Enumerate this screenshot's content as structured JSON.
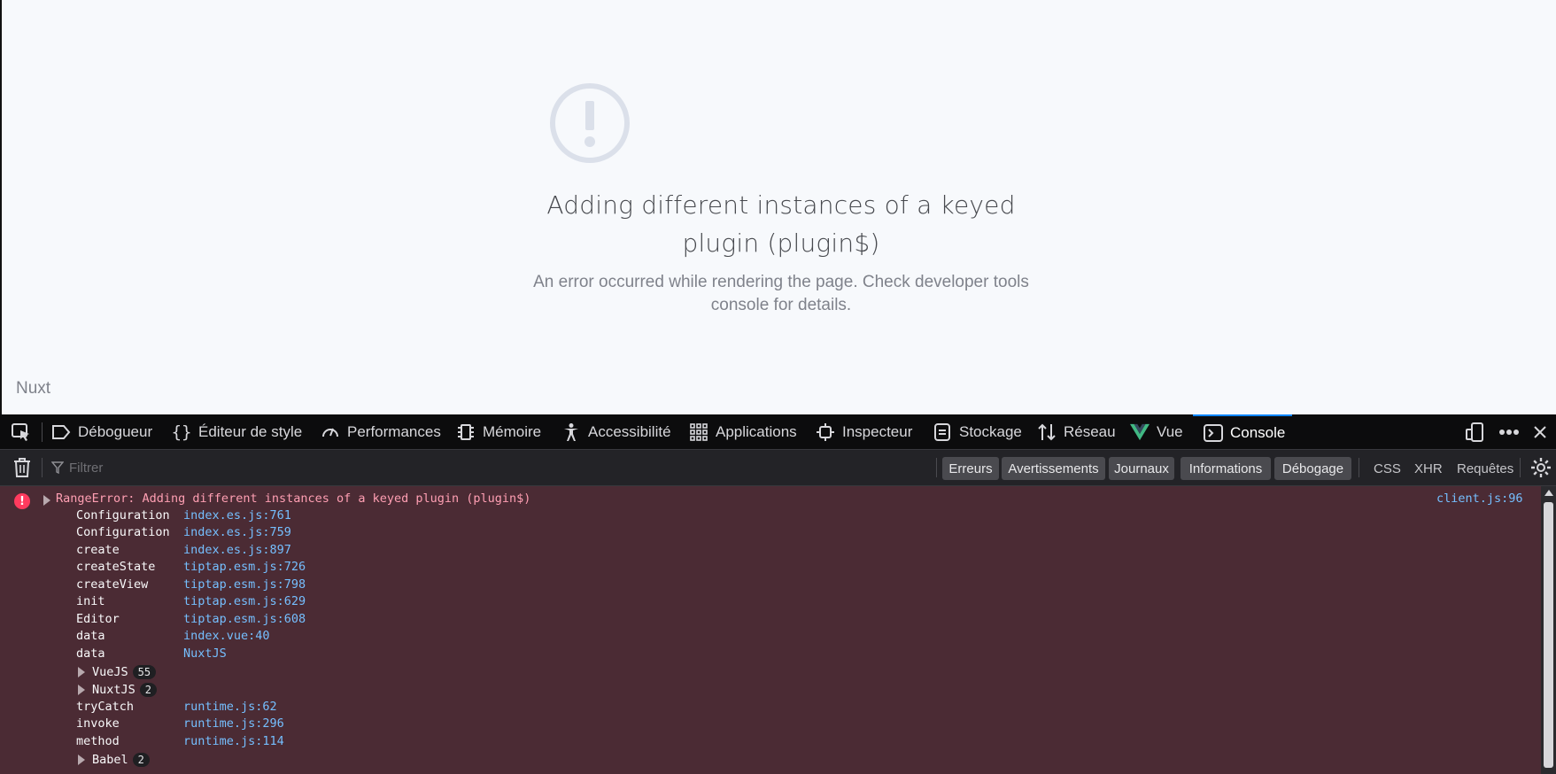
{
  "page": {
    "error_title": "Adding different instances of a keyed plugin (plugin$)",
    "error_description": "An error occurred while rendering the page. Check developer tools console for details.",
    "brand": "Nuxt"
  },
  "devtools": {
    "tabs": [
      {
        "label": "Débogueur",
        "icon": "debugger-icon"
      },
      {
        "label": "Éditeur de style",
        "icon": "braces-icon"
      },
      {
        "label": "Performances",
        "icon": "gauge-icon"
      },
      {
        "label": "Mémoire",
        "icon": "memory-chip-icon"
      },
      {
        "label": "Accessibilité",
        "icon": "accessibility-icon"
      },
      {
        "label": "Applications",
        "icon": "grid-icon"
      },
      {
        "label": "Inspecteur",
        "icon": "inspector-icon"
      },
      {
        "label": "Stockage",
        "icon": "storage-icon"
      },
      {
        "label": "Réseau",
        "icon": "network-arrows-icon"
      },
      {
        "label": "Vue",
        "icon": "vue-logo-icon"
      },
      {
        "label": "Console",
        "icon": "console-icon",
        "active": true
      }
    ],
    "toolbar": {
      "filter_placeholder": "Filtrer",
      "levels": [
        "Erreurs",
        "Avertissements",
        "Journaux",
        "Informations",
        "Débogage"
      ],
      "request_filters": [
        "CSS",
        "XHR",
        "Requêtes"
      ]
    },
    "console": {
      "error_message": "RangeError: Adding different instances of a keyed plugin (plugin$)",
      "error_source": "client.js:96",
      "frames": [
        {
          "fn": "Configuration",
          "loc": "index.es.js:761"
        },
        {
          "fn": "Configuration",
          "loc": "index.es.js:759"
        },
        {
          "fn": "create",
          "loc": "index.es.js:897"
        },
        {
          "fn": "createState",
          "loc": "tiptap.esm.js:726"
        },
        {
          "fn": "createView",
          "loc": "tiptap.esm.js:798"
        },
        {
          "fn": "init",
          "loc": "tiptap.esm.js:629"
        },
        {
          "fn": "Editor",
          "loc": "tiptap.esm.js:608"
        },
        {
          "fn": "data",
          "loc": "index.vue:40"
        },
        {
          "fn": "data",
          "loc": "NuxtJS"
        }
      ],
      "groups_a": [
        {
          "name": "VueJS",
          "count": "55"
        },
        {
          "name": "NuxtJS",
          "count": "2"
        }
      ],
      "frames_b": [
        {
          "fn": "tryCatch",
          "loc": "runtime.js:62"
        },
        {
          "fn": "invoke",
          "loc": "runtime.js:296"
        },
        {
          "fn": "method",
          "loc": "runtime.js:114"
        }
      ],
      "groups_b": [
        {
          "name": "Babel",
          "count": "2"
        }
      ]
    }
  }
}
